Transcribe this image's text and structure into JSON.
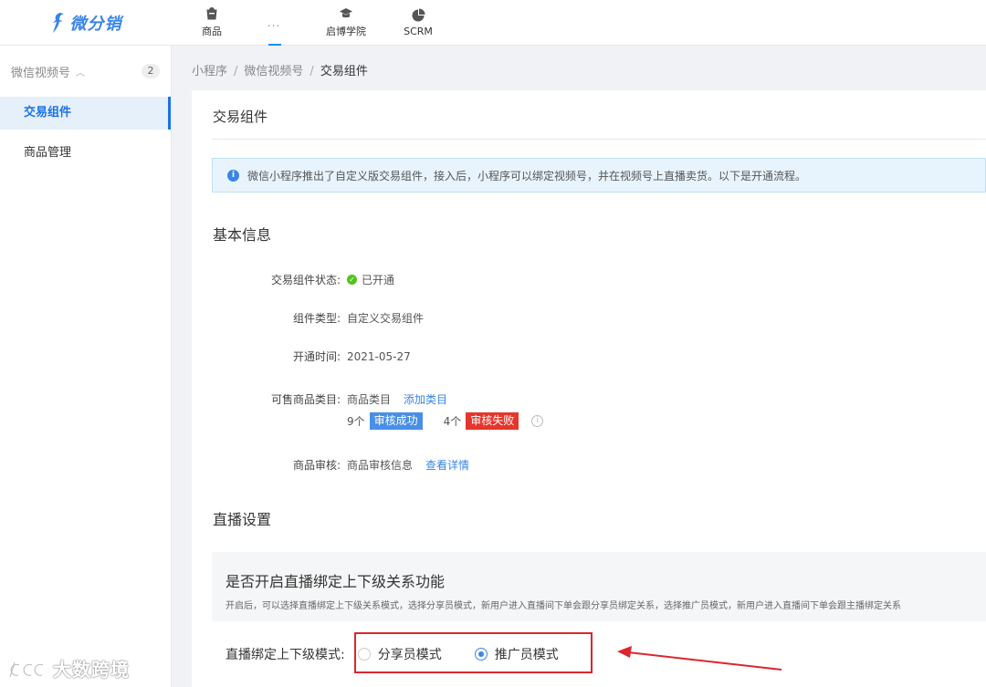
{
  "app": {
    "logo_text": "微分销"
  },
  "topnav": [
    {
      "label": "商品",
      "icon": "bag-icon"
    },
    {
      "label": "...",
      "icon": "more-icon"
    },
    {
      "label": "启博学院",
      "icon": "graduation-cap-icon"
    },
    {
      "label": "SCRM",
      "icon": "pie-chart-icon"
    }
  ],
  "sidebar": {
    "group_label": "微信视频号",
    "group_count": "2",
    "items": [
      {
        "label": "交易组件",
        "active": true
      },
      {
        "label": "商品管理",
        "active": false
      }
    ]
  },
  "breadcrumb": [
    "小程序",
    "微信视频号",
    "交易组件"
  ],
  "page": {
    "title": "交易组件",
    "notice": "微信小程序推出了自定义版交易组件，接入后，小程序可以绑定视频号，并在视频号上直播卖货。以下是开通流程。",
    "basic_info_title": "基本信息",
    "fields": {
      "status_label": "交易组件状态:",
      "status_value": "已开通",
      "type_label": "组件类型:",
      "type_value": "自定义交易组件",
      "time_label": "开通时间:",
      "time_value": "2021-05-27",
      "category_label": "可售商品类目:",
      "category_value": "商品类目",
      "category_link": "添加类目",
      "success_count": "9个",
      "success_tag": "审核成功",
      "fail_count": "4个",
      "fail_tag": "审核失败",
      "review_label": "商品审核:",
      "review_value": "商品审核信息",
      "review_link": "查看详情"
    },
    "live_title": "直播设置",
    "live_box_heading": "是否开启直播绑定上下级关系功能",
    "live_box_desc": "开启后，可以选择直播绑定上下级关系模式，选择分享员模式，新用户进入直播间下单会跟分享员绑定关系，选择推广员模式，新用户进入直播间下单会跟主播绑定关系",
    "mode_label": "直播绑定上下级模式:",
    "mode_options": [
      {
        "label": "分享员模式",
        "selected": false
      },
      {
        "label": "推广员模式",
        "selected": true
      }
    ]
  },
  "watermark": "大数跨境",
  "colors": {
    "accent": "#3a85e6",
    "success": "#52c41a",
    "danger": "#e5362c",
    "highlight": "#d9272e"
  }
}
